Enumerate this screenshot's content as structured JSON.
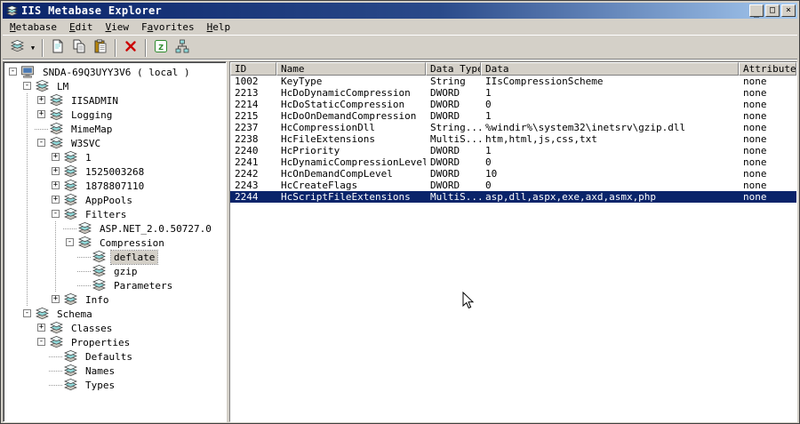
{
  "window": {
    "title": "IIS Metabase Explorer",
    "controls": {
      "minimize": "_",
      "maximize": "□",
      "close": "×"
    }
  },
  "menu": [
    {
      "label": "Metabase",
      "underline": 0
    },
    {
      "label": "Edit",
      "underline": 0
    },
    {
      "label": "View",
      "underline": 0
    },
    {
      "label": "Favorites",
      "underline": 1
    },
    {
      "label": "Help",
      "underline": 0
    }
  ],
  "toolbar": [
    {
      "type": "button",
      "name": "connect",
      "icon": "metabase-icon",
      "dropdown": true
    },
    {
      "type": "separator"
    },
    {
      "type": "button",
      "name": "new-key",
      "icon": "new-key-icon"
    },
    {
      "type": "button",
      "name": "copy",
      "icon": "copy-icon"
    },
    {
      "type": "button",
      "name": "paste",
      "icon": "paste-icon"
    },
    {
      "type": "separator"
    },
    {
      "type": "button",
      "name": "delete",
      "icon": "delete-icon"
    },
    {
      "type": "separator"
    },
    {
      "type": "button",
      "name": "script",
      "icon": "script-icon"
    },
    {
      "type": "button",
      "name": "network",
      "icon": "network-icon"
    }
  ],
  "tree": [
    {
      "label": "SNDA-69Q3UYY3V6 ( local )",
      "level": 0,
      "expander": "minus",
      "icon": "computer",
      "selected": false
    },
    {
      "label": "LM",
      "level": 1,
      "expander": "minus",
      "icon": "metabase",
      "selected": false
    },
    {
      "label": "IISADMIN",
      "level": 2,
      "expander": "plus",
      "icon": "metabase",
      "selected": false
    },
    {
      "label": "Logging",
      "level": 2,
      "expander": "plus",
      "icon": "metabase",
      "selected": false
    },
    {
      "label": "MimeMap",
      "level": 2,
      "expander": "none",
      "icon": "metabase",
      "selected": false
    },
    {
      "label": "W3SVC",
      "level": 2,
      "expander": "minus",
      "icon": "metabase",
      "selected": false
    },
    {
      "label": "1",
      "level": 3,
      "expander": "plus",
      "icon": "metabase",
      "selected": false
    },
    {
      "label": "1525003268",
      "level": 3,
      "expander": "plus",
      "icon": "metabase",
      "selected": false
    },
    {
      "label": "1878807110",
      "level": 3,
      "expander": "plus",
      "icon": "metabase",
      "selected": false
    },
    {
      "label": "AppPools",
      "level": 3,
      "expander": "plus",
      "icon": "metabase",
      "selected": false
    },
    {
      "label": "Filters",
      "level": 3,
      "expander": "minus",
      "icon": "metabase",
      "selected": false
    },
    {
      "label": "ASP.NET_2.0.50727.0",
      "level": 4,
      "expander": "none",
      "icon": "metabase",
      "selected": false
    },
    {
      "label": "Compression",
      "level": 4,
      "expander": "minus",
      "icon": "metabase",
      "selected": false
    },
    {
      "label": "deflate",
      "level": 5,
      "expander": "none",
      "icon": "metabase",
      "selected": true
    },
    {
      "label": "gzip",
      "level": 5,
      "expander": "none",
      "icon": "metabase",
      "selected": false
    },
    {
      "label": "Parameters",
      "level": 5,
      "expander": "none",
      "icon": "metabase",
      "selected": false
    },
    {
      "label": "Info",
      "level": 3,
      "expander": "plus",
      "icon": "metabase",
      "selected": false
    },
    {
      "label": "Schema",
      "level": 1,
      "expander": "minus",
      "icon": "metabase",
      "selected": false
    },
    {
      "label": "Classes",
      "level": 2,
      "expander": "plus",
      "icon": "metabase",
      "selected": false
    },
    {
      "label": "Properties",
      "level": 2,
      "expander": "minus",
      "icon": "metabase",
      "selected": false
    },
    {
      "label": "Defaults",
      "level": 3,
      "expander": "none",
      "icon": "metabase",
      "selected": false
    },
    {
      "label": "Names",
      "level": 3,
      "expander": "none",
      "icon": "metabase",
      "selected": false
    },
    {
      "label": "Types",
      "level": 3,
      "expander": "none",
      "icon": "metabase",
      "selected": false
    }
  ],
  "table": {
    "columns": [
      {
        "label": "ID"
      },
      {
        "label": "Name"
      },
      {
        "label": "Data Type"
      },
      {
        "label": "Data"
      },
      {
        "label": "Attributes"
      }
    ],
    "rows": [
      [
        "1002",
        "KeyType",
        "String",
        "IIsCompressionScheme",
        "none"
      ],
      [
        "2213",
        "HcDoDynamicCompression",
        "DWORD",
        "1",
        "none"
      ],
      [
        "2214",
        "HcDoStaticCompression",
        "DWORD",
        "0",
        "none"
      ],
      [
        "2215",
        "HcDoOnDemandCompression",
        "DWORD",
        "1",
        "none"
      ],
      [
        "2237",
        "HcCompressionDll",
        "String...",
        "%windir%\\system32\\inetsrv\\gzip.dll",
        "none"
      ],
      [
        "2238",
        "HcFileExtensions",
        "MultiS...",
        "htm,html,js,css,txt",
        "none"
      ],
      [
        "2240",
        "HcPriority",
        "DWORD",
        "1",
        "none"
      ],
      [
        "2241",
        "HcDynamicCompressionLevel",
        "DWORD",
        "0",
        "none"
      ],
      [
        "2242",
        "HcOnDemandCompLevel",
        "DWORD",
        "10",
        "none"
      ],
      [
        "2243",
        "HcCreateFlags",
        "DWORD",
        "0",
        "none"
      ],
      [
        "2244",
        "HcScriptFileExtensions",
        "MultiS...",
        "asp,dll,aspx,exe,axd,asmx,php",
        "none"
      ]
    ],
    "selected_row": 10
  }
}
